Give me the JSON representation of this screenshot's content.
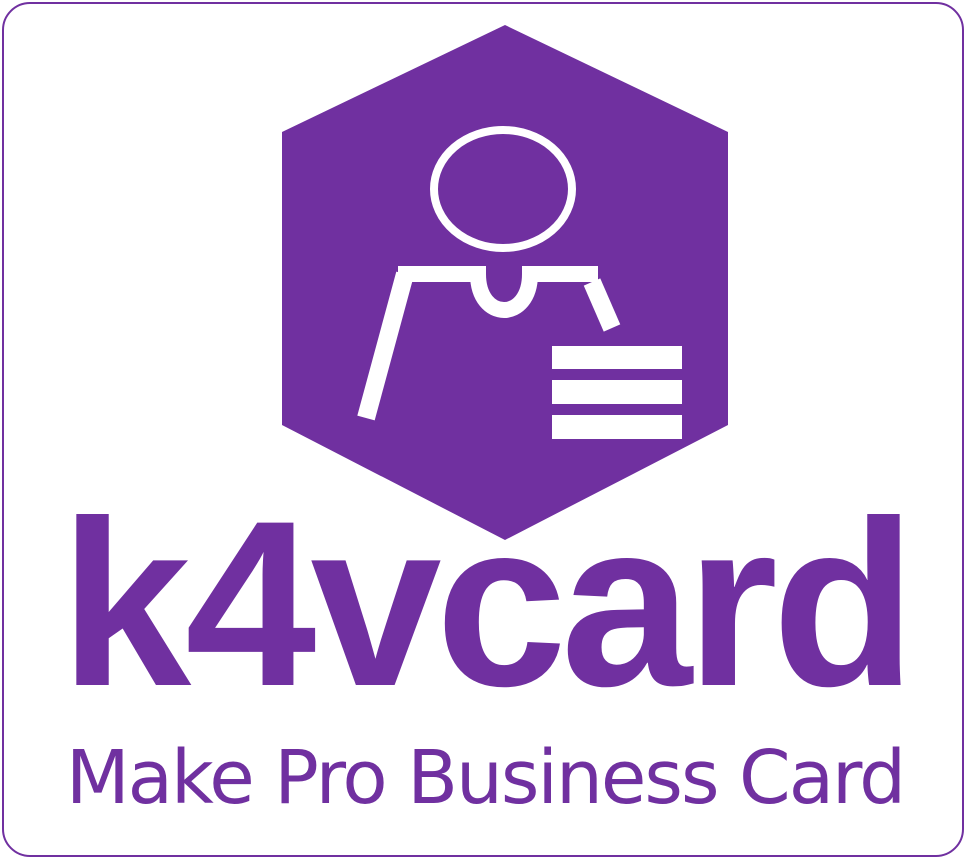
{
  "logo": {
    "name": "k4vcard",
    "tagline": "Make Pro Business Card",
    "icon": "person-card-icon"
  },
  "colors": {
    "brand": "#7030a0",
    "background": "#ffffff",
    "icon_foreground": "#ffffff"
  }
}
